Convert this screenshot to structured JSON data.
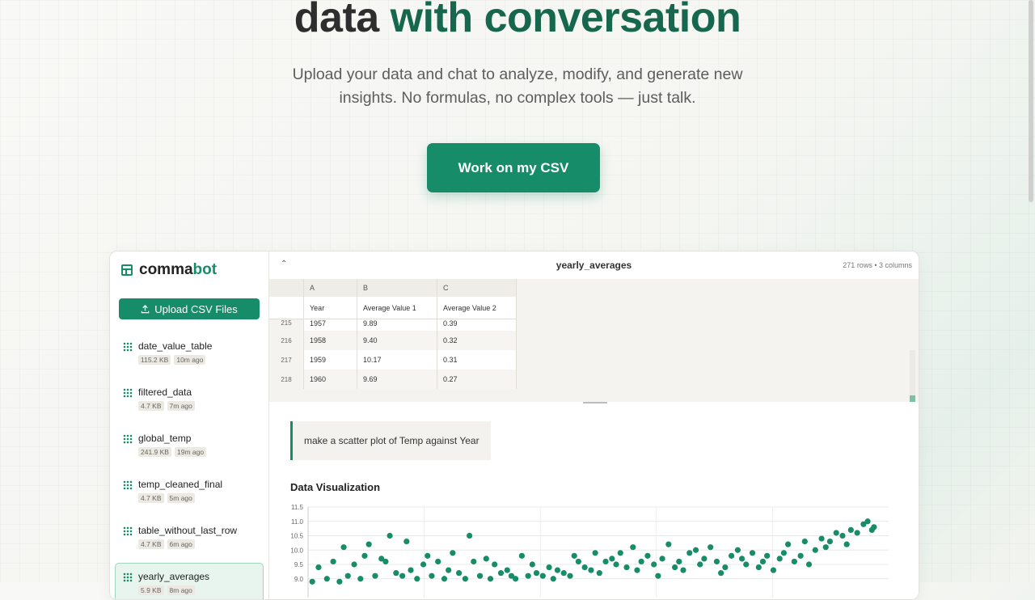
{
  "hero": {
    "title_plain": "data ",
    "title_accent": "with conversation",
    "subtitle": "Upload your data and chat to analyze, modify, and generate new insights. No formulas, no complex tools — just talk.",
    "cta_label": "Work on my CSV"
  },
  "app": {
    "brand": {
      "part1": "comma",
      "part2": "bot"
    },
    "upload_label": "Upload CSV Files",
    "files": [
      {
        "name": "date_value_table",
        "size": "115.2 KB",
        "age": "10m ago"
      },
      {
        "name": "filtered_data",
        "size": "4.7 KB",
        "age": "7m ago"
      },
      {
        "name": "global_temp",
        "size": "241.9 KB",
        "age": "19m ago"
      },
      {
        "name": "temp_cleaned_final",
        "size": "4.7 KB",
        "age": "5m ago"
      },
      {
        "name": "table_without_last_row",
        "size": "4.7 KB",
        "age": "6m ago"
      },
      {
        "name": "yearly_averages",
        "size": "5.9 KB",
        "age": "8m ago"
      }
    ],
    "sheet": {
      "title": "yearly_averages",
      "info": "271 rows • 3 columns",
      "col_letters": [
        "A",
        "B",
        "C"
      ],
      "col_names": [
        "Year",
        "Average Value 1",
        "Average Value 2"
      ],
      "rows": [
        {
          "n": "215",
          "cells": [
            "1957",
            "9.89",
            "0.39"
          ]
        },
        {
          "n": "216",
          "cells": [
            "1958",
            "9.40",
            "0.32"
          ]
        },
        {
          "n": "217",
          "cells": [
            "1959",
            "10.17",
            "0.31"
          ]
        },
        {
          "n": "218",
          "cells": [
            "1960",
            "9.69",
            "0.27"
          ]
        }
      ]
    },
    "chat": {
      "user_message": "make a scatter plot of Temp against Year",
      "viz_title": "Data Visualization"
    }
  },
  "chart_data": {
    "type": "scatter",
    "yticks": [
      "11.5",
      "11.0",
      "10.5",
      "10.0",
      "9.5",
      "9.0"
    ],
    "ylim": [
      8.8,
      11.5
    ],
    "xlim": [
      1743,
      2020
    ],
    "color": "#178c69",
    "x": [
      1745,
      1748,
      1752,
      1755,
      1758,
      1760,
      1762,
      1765,
      1768,
      1770,
      1772,
      1775,
      1778,
      1780,
      1782,
      1785,
      1788,
      1790,
      1792,
      1795,
      1798,
      1800,
      1802,
      1805,
      1808,
      1810,
      1812,
      1815,
      1818,
      1820,
      1822,
      1825,
      1828,
      1830,
      1832,
      1835,
      1838,
      1840,
      1842,
      1845,
      1848,
      1850,
      1852,
      1855,
      1858,
      1860,
      1862,
      1865,
      1868,
      1870,
      1872,
      1875,
      1878,
      1880,
      1882,
      1885,
      1888,
      1890,
      1892,
      1895,
      1898,
      1900,
      1902,
      1905,
      1908,
      1910,
      1912,
      1915,
      1918,
      1920,
      1922,
      1925,
      1928,
      1930,
      1932,
      1935,
      1938,
      1940,
      1942,
      1945,
      1948,
      1950,
      1952,
      1955,
      1958,
      1960,
      1962,
      1965,
      1968,
      1970,
      1972,
      1975,
      1978,
      1980,
      1982,
      1985,
      1988,
      1990,
      1992,
      1995,
      1998,
      2000,
      2002,
      2005,
      2008,
      2010,
      2012,
      2013
    ],
    "y": [
      8.9,
      9.4,
      9.0,
      9.6,
      8.9,
      10.1,
      9.1,
      9.5,
      9.0,
      9.8,
      10.2,
      9.1,
      9.7,
      9.6,
      10.5,
      9.2,
      9.1,
      10.3,
      9.3,
      9.0,
      9.5,
      9.8,
      9.1,
      9.6,
      9.0,
      9.3,
      9.9,
      9.2,
      9.0,
      10.5,
      9.6,
      9.1,
      9.7,
      9.0,
      9.5,
      9.2,
      9.3,
      9.1,
      9.0,
      9.8,
      9.1,
      9.5,
      9.2,
      9.1,
      9.4,
      9.0,
      9.3,
      9.2,
      9.1,
      9.8,
      9.6,
      9.4,
      9.3,
      9.9,
      9.2,
      9.6,
      9.7,
      9.5,
      9.9,
      9.4,
      10.1,
      9.3,
      9.6,
      9.8,
      9.5,
      9.1,
      9.7,
      10.2,
      9.4,
      9.6,
      9.3,
      9.9,
      10.0,
      9.5,
      9.7,
      10.1,
      9.6,
      9.2,
      9.4,
      9.8,
      10.0,
      9.7,
      9.5,
      9.9,
      9.4,
      9.6,
      9.8,
      9.3,
      9.7,
      9.9,
      10.2,
      9.6,
      9.8,
      10.3,
      9.5,
      10.0,
      10.4,
      10.1,
      10.3,
      10.6,
      10.5,
      10.2,
      10.7,
      10.6,
      10.9,
      11.0,
      10.7,
      10.8
    ]
  }
}
